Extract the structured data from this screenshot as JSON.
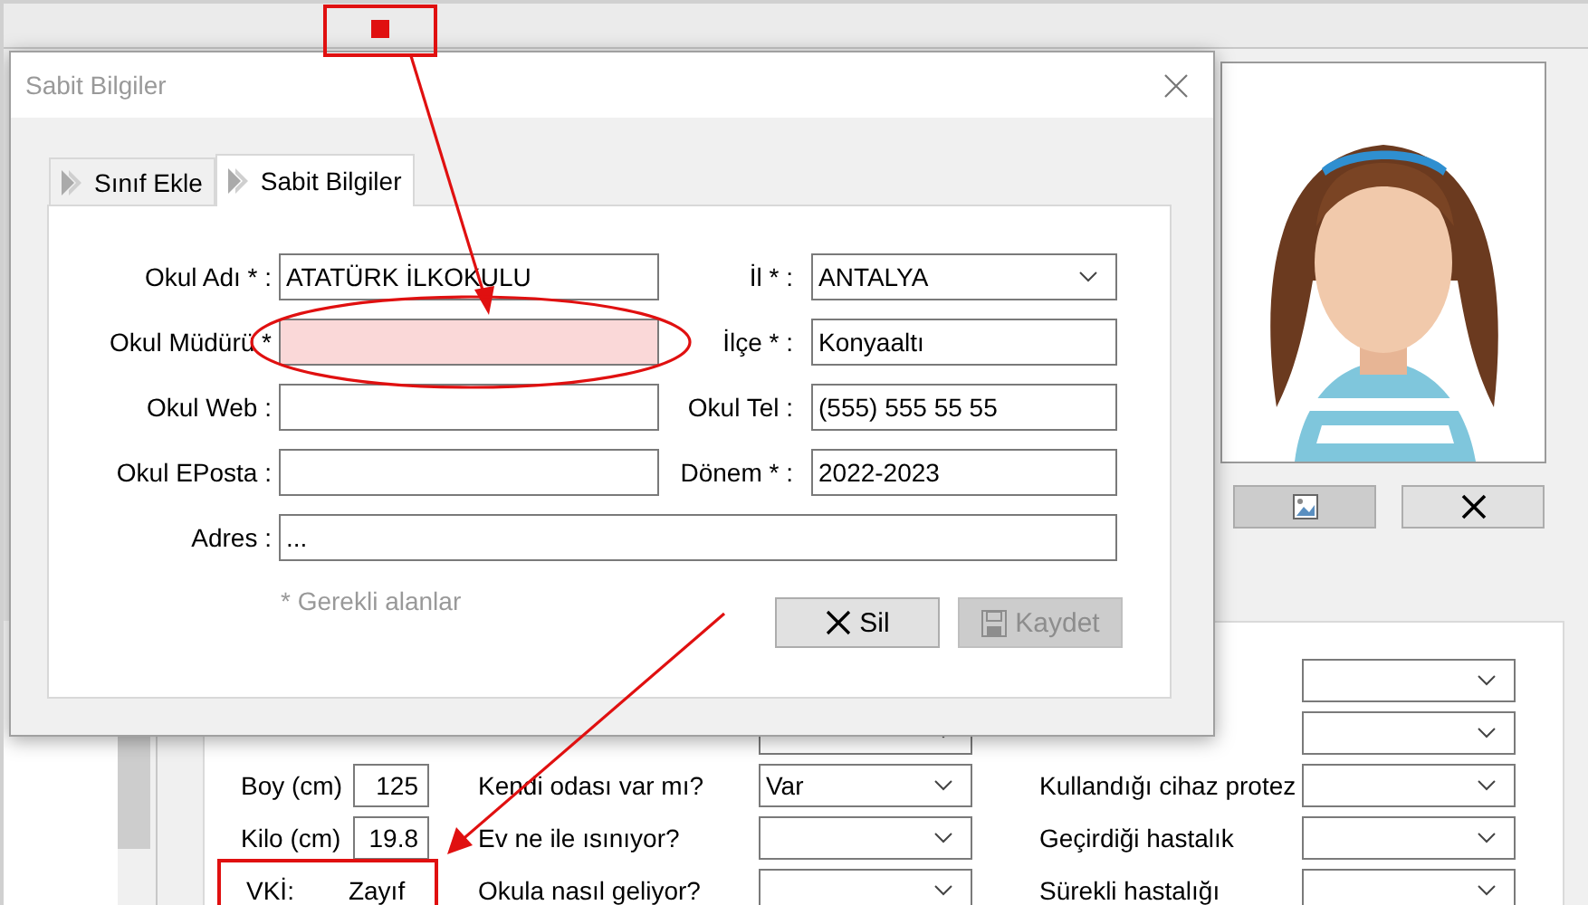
{
  "dialog": {
    "title": "Sabit Bilgiler",
    "tabs": [
      {
        "label": "Sınıf Ekle",
        "selected": false
      },
      {
        "label": "Sabit Bilgiler",
        "selected": true
      }
    ],
    "fields": [
      {
        "label": "Okul Adı * :",
        "kind": "text",
        "value": "ATATÜRK İLKOKULU",
        "invalid": false
      },
      {
        "label": "İl * :",
        "kind": "select",
        "value": "ANTALYA",
        "invalid": false
      },
      {
        "label": "Okul Müdürü *",
        "kind": "text",
        "invalid": true
      },
      {
        "label": "İlçe * :",
        "kind": "text",
        "value": "Konyaaltı",
        "invalid": false
      },
      {
        "label": "Okul Web :",
        "kind": "text",
        "invalid": false
      },
      {
        "label": "Okul Tel :",
        "kind": "text",
        "value": "(555) 555 55 55",
        "invalid": false
      },
      {
        "label": "Okul EPosta :",
        "kind": "text",
        "invalid": false
      },
      {
        "label": "Dönem * :",
        "kind": "text",
        "value": "2022-2023",
        "invalid": false
      },
      {
        "label": "Adres :",
        "kind": "wide",
        "value": "...",
        "invalid": false
      }
    ],
    "note": "* Gerekli alanlar",
    "buttons": [
      {
        "label": "Sil",
        "kind": "delete",
        "disabled": false
      },
      {
        "label": "Kaydet",
        "kind": "save",
        "disabled": true
      }
    ]
  },
  "health": {
    "rows": [
      {
        "condition": {
          "kind": "select"
        }
      },
      {
        "question": {
          "kind": "select"
        },
        "condition": {
          "kind": "select"
        }
      },
      {
        "measure": {
          "label": "Boy (cm)",
          "value": "125",
          "kind": "input"
        },
        "question": {
          "label": "Kendi odası var mı?",
          "kind": "select",
          "value": "Var"
        },
        "condition": {
          "label": "Kullandığı cihaz protez",
          "kind": "select"
        }
      },
      {
        "measure": {
          "label": "Kilo (cm)",
          "value": "19.8",
          "kind": "input"
        },
        "question": {
          "label": "Ev ne ile ısınıyor?",
          "kind": "select"
        },
        "condition": {
          "label": "Geçirdiği hastalık",
          "kind": "select"
        }
      },
      {
        "measure": {
          "label": "VKİ:",
          "value": "Zayıf",
          "kind": "readout"
        },
        "question": {
          "label": "Okula nasıl geliyor?",
          "kind": "select"
        },
        "condition": {
          "label": "Sürekli hastalığı",
          "kind": "select"
        }
      }
    ]
  }
}
